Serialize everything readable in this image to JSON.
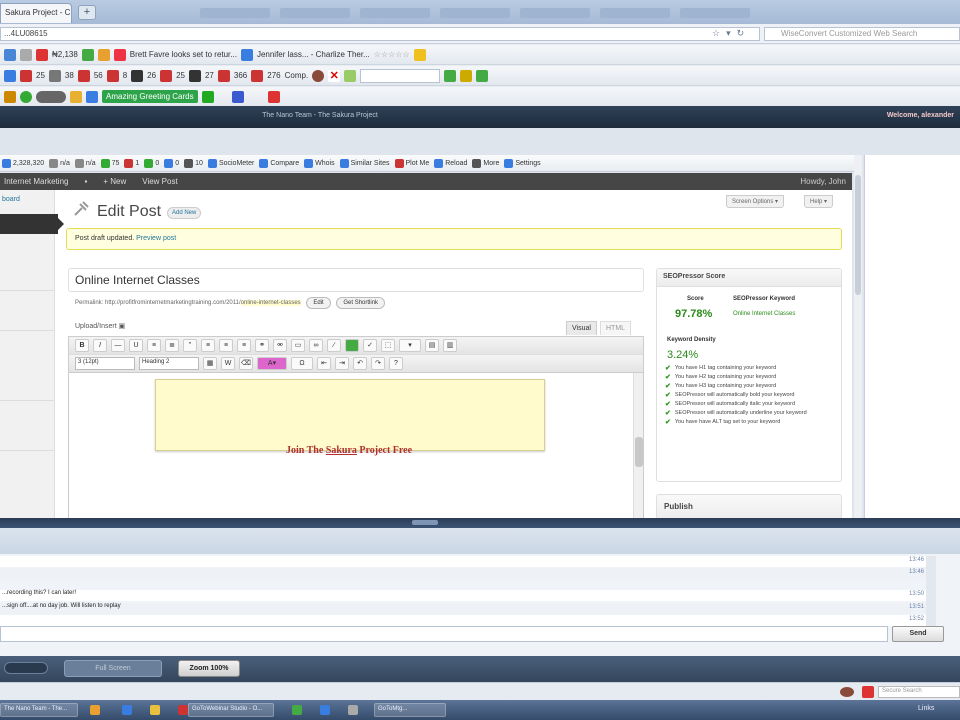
{
  "browser": {
    "tab_title": "Sakura Project - C...",
    "new_tab": "+",
    "url": "...4LU08615",
    "search_placeholder": "WiseConvert Customized Web Search",
    "stars": "☆☆☆☆☆"
  },
  "toolbars": {
    "row1": [
      "Brett Favre looks set to retur...",
      "Jennifer lass... - Charlize Ther..."
    ],
    "row1_count": "₦2,138",
    "row2": [
      "25",
      "38",
      "56",
      "8",
      "26",
      "25",
      "27",
      "366",
      "276",
      "Comp."
    ],
    "row3": {
      "greeting_button": "Amazing Greeting Cards"
    }
  },
  "site": {
    "title": "The Nano Team - The Sakura Project",
    "welcome": "Welcome, alexander"
  },
  "seo_bar": {
    "items": [
      "2,328,320",
      "n/a",
      "n/a",
      "75",
      "1",
      "0",
      "0",
      "10",
      "SocioMeter",
      "Compare",
      "Whois",
      "Similar Sites",
      "Plot Me",
      "Reload",
      "More",
      "Settings"
    ]
  },
  "wp": {
    "admin_bar": {
      "site": "Internet Marketing",
      "new": "New",
      "view": "View Post",
      "howdy": "Howdy, John"
    },
    "sidebar_top": "board",
    "page_title": "Edit Post",
    "add_new": "Add New",
    "screen_options": "Screen Options ▾",
    "help": "Help ▾",
    "notice": "Post draft updated.",
    "notice_link": "Preview post",
    "post_title": "Online Internet Classes",
    "permalink_label": "Permalink:",
    "permalink_base": "http://profitfrominternetmarketingtraining.com/2011/",
    "permalink_slug": "online-internet-classes",
    "edit_btn": "Edit",
    "shortlink_btn": "Get Shortlink",
    "upload_insert": "Upload/Insert",
    "tab_visual": "Visual",
    "tab_html": "HTML",
    "font_size": "3 (12pt)",
    "format": "Heading 2",
    "join_prefix": "Join The ",
    "join_link": "Sakura",
    "join_suffix": " Project Free"
  },
  "seopressor": {
    "title": "SEOPressor Score",
    "score_label": "Score",
    "keyword_label": "SEOPressor Keyword",
    "score": "97.78%",
    "keyword": "Online Internet Classes",
    "density_label": "Keyword Density",
    "density": "3.24%",
    "checks": [
      "You have H1 tag containing your keyword",
      "You have H2 tag containing your keyword",
      "You have H3 tag containing your keyword",
      "SEOPressor will automatically bold your keyword",
      "SEOPressor will automatically italic your keyword",
      "SEOPressor will automatically underline your keyword",
      "You have have ALT tag set to your keyword"
    ]
  },
  "publish": {
    "title": "Publish"
  },
  "chat": {
    "messages": [
      {
        "text": "",
        "time": "13:46"
      },
      {
        "text": "",
        "time": "13:46"
      },
      {
        "text": "...recording this? I can later!",
        "time": "13:50"
      },
      {
        "text": "...sign off....at no day job. Will listen to replay",
        "time": "13:51"
      },
      {
        "text": "",
        "time": "13:52"
      }
    ],
    "send": "Send"
  },
  "controls": {
    "fullscreen": "Full Screen",
    "zoom": "Zoom 100%"
  },
  "status": {
    "search_placeholder": "Secure Search"
  },
  "taskbar": {
    "items": [
      "The Nano Team - The...",
      "GoToWebinar Studio - O...",
      "GoToMtg..."
    ],
    "tray": "Links"
  },
  "colors": {
    "accent": "#21759b",
    "seo_green": "#2a8a1a",
    "title_red": "#b03030",
    "notice_bg": "#ffffe0"
  }
}
